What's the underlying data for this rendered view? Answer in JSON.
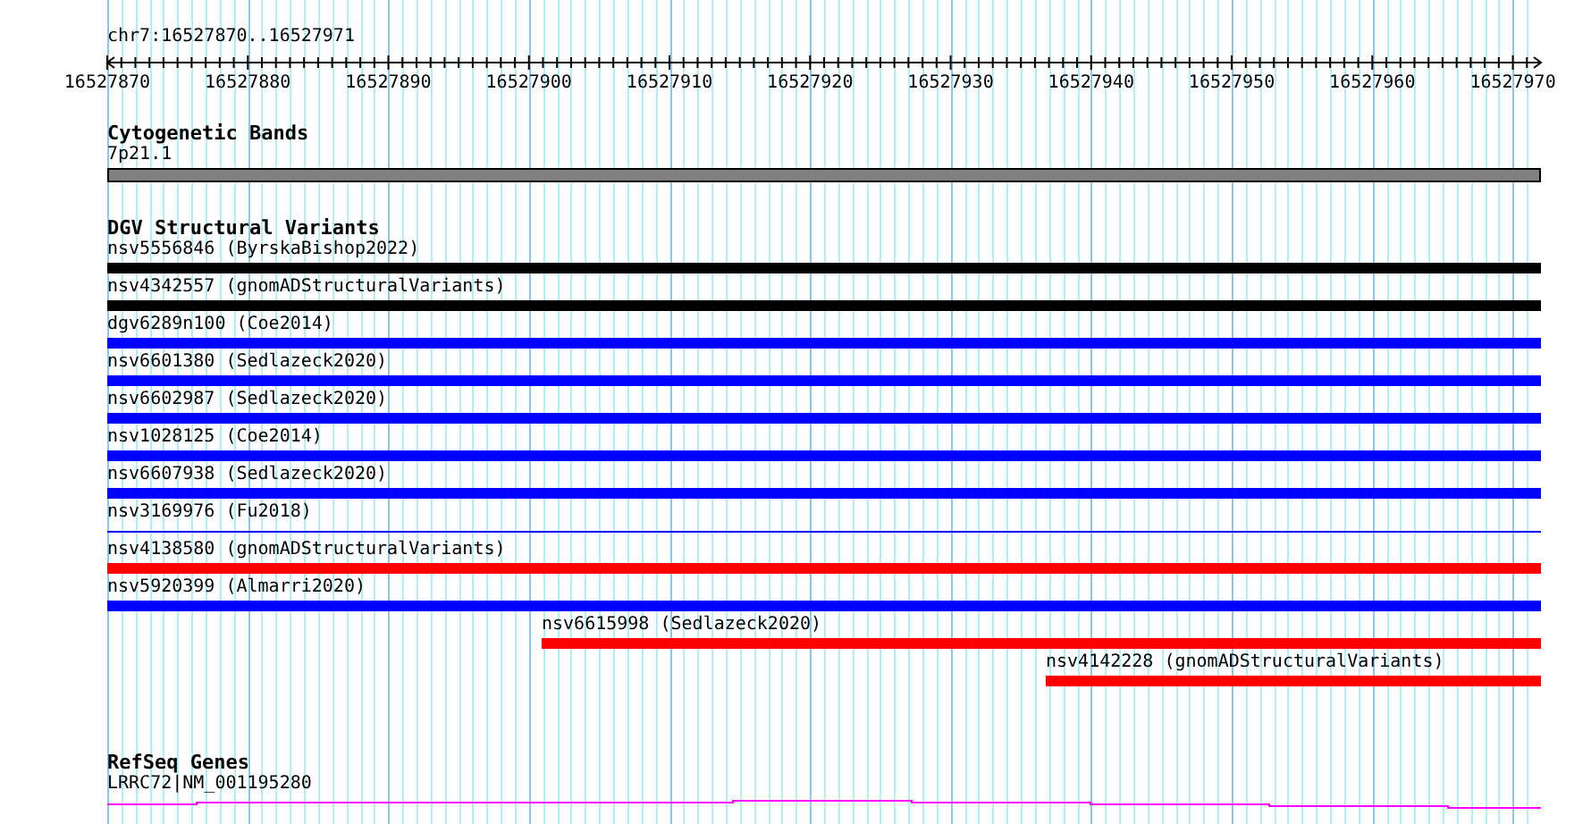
{
  "region": "chr7:16527870..16527971",
  "ruler": {
    "ticks": [
      "16527870",
      "16527880",
      "16527890",
      "16527900",
      "16527910",
      "16527920",
      "16527930",
      "16527940",
      "16527950",
      "16527960",
      "16527970"
    ]
  },
  "tracks": [
    {
      "kind": "band",
      "title": "Cytogenetic Bands",
      "features": [
        {
          "label": "7p21.1",
          "color": "#808080"
        }
      ]
    },
    {
      "kind": "variants",
      "title": "DGV Structural Variants",
      "features": [
        {
          "label": "nsv5556846 (ByrskaBishop2022)",
          "color": "#000000",
          "kind": "bar"
        },
        {
          "label": "nsv4342557 (gnomADStructuralVariants)",
          "color": "#000000",
          "kind": "bar"
        },
        {
          "label": "dgv6289n100 (Coe2014)",
          "color": "#0000ff",
          "kind": "bar"
        },
        {
          "label": "nsv6601380 (Sedlazeck2020)",
          "color": "#0000ff",
          "kind": "bar"
        },
        {
          "label": "nsv6602987 (Sedlazeck2020)",
          "color": "#0000ff",
          "kind": "bar"
        },
        {
          "label": "nsv1028125 (Coe2014)",
          "color": "#0000ff",
          "kind": "bar"
        },
        {
          "label": "nsv6607938 (Sedlazeck2020)",
          "color": "#0000ff",
          "kind": "bar"
        },
        {
          "label": "nsv3169976 (Fu2018)",
          "color": "#0000ff",
          "kind": "line"
        },
        {
          "label": "nsv4138580 (gnomADStructuralVariants)",
          "color": "#ff0000",
          "kind": "bar"
        },
        {
          "label": "nsv5920399 (Almarri2020)",
          "color": "#0000ff",
          "kind": "bar"
        },
        {
          "label": "nsv6615998 (Sedlazeck2020)",
          "color": "#ff0000",
          "kind": "bar"
        },
        {
          "label": "nsv4142228 (gnomADStructuralVariants)",
          "color": "#ff0000",
          "kind": "bar"
        }
      ]
    },
    {
      "kind": "genes",
      "title": "RefSeq Genes",
      "features": [
        {
          "label": "LRRC72|NM_001195280",
          "color": "#ff00ff"
        }
      ]
    }
  ]
}
